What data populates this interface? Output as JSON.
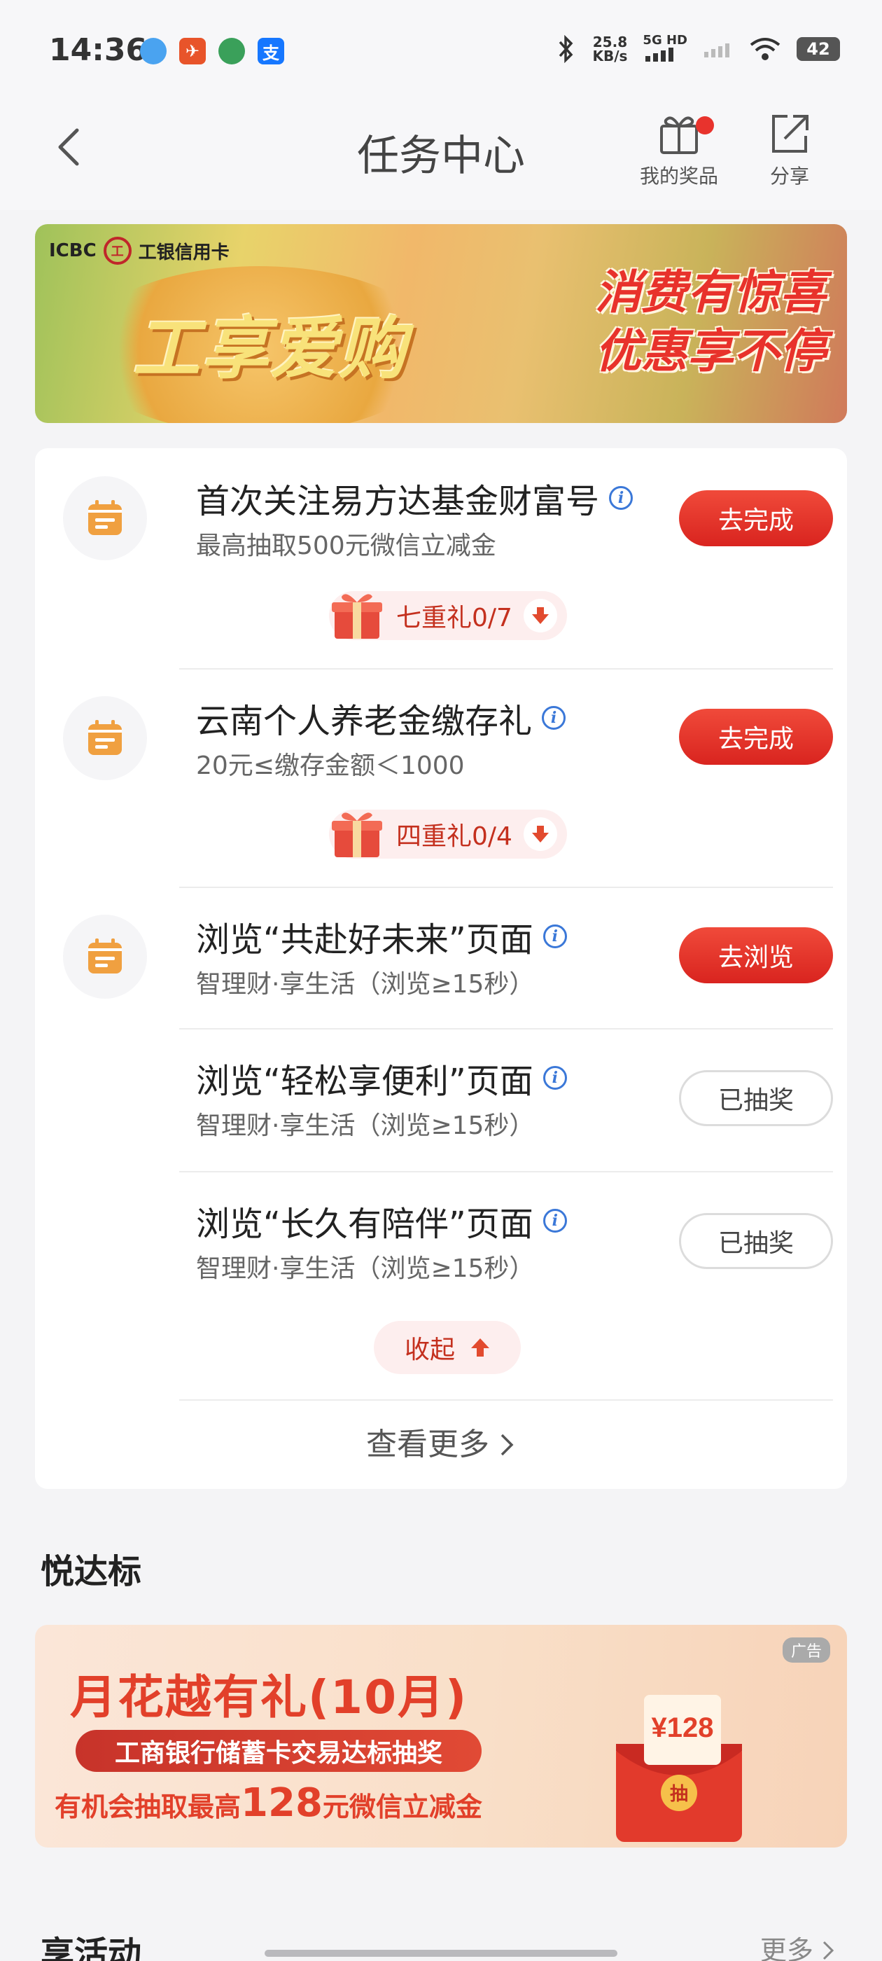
{
  "status_bar": {
    "time": "14:36",
    "apps": [
      {
        "icon": "qq-browser-icon",
        "label": "",
        "color": "#4aa3f0"
      },
      {
        "icon": "app-orange-icon",
        "label": "",
        "color": "#e8542a"
      },
      {
        "icon": "app-green-icon",
        "label": "",
        "color": "#3aa05a"
      },
      {
        "icon": "alipay-icon",
        "label": "支",
        "color": "#1677ff"
      }
    ],
    "net_speed_value": "25.8",
    "net_speed_unit": "KB/s",
    "net_type": "5G HD",
    "battery": "42"
  },
  "header": {
    "title": "任务中心",
    "prizes_label": "我的奖品",
    "share_label": "分享"
  },
  "banner": {
    "bank_label": "ICBC",
    "card_label": "工银信用卡",
    "brand_text": "工享爱购",
    "slogan_line1": "消费有惊喜",
    "slogan_line2": "优惠享不停"
  },
  "tasks": [
    {
      "title": "首次关注易方达基金财富号",
      "subtitle": "最高抽取500元微信立减金",
      "button": "去完成",
      "state": "todo",
      "gift": "七重礼0/7"
    },
    {
      "title": "云南个人养老金缴存礼",
      "subtitle": "20元≤缴存金额＜1000",
      "button": "去完成",
      "state": "todo",
      "gift": "四重礼0/4"
    },
    {
      "title": "浏览“共赴好未来”页面",
      "subtitle": "智理财·享生活（浏览≥15秒）",
      "button": "去浏览",
      "state": "todo"
    },
    {
      "title": "浏览“轻松享便利”页面",
      "subtitle": "智理财·享生活（浏览≥15秒）",
      "button": "已抽奖",
      "state": "done"
    },
    {
      "title": "浏览“长久有陪伴”页面",
      "subtitle": "智理财·享生活（浏览≥15秒）",
      "button": "已抽奖",
      "state": "done"
    }
  ],
  "collapse_label": "收起",
  "more_label": "查看更多",
  "section_yueda": "悦达标",
  "ad": {
    "badge": "广告",
    "title": "月花越有礼(10月)",
    "strip": "工商银行储蓄卡交易达标抽奖",
    "line_prefix": "有机会抽取最高",
    "line_amount": "128",
    "line_suffix": "元微信立减金",
    "envelope_amount": "¥128",
    "envelope_char": "抽"
  },
  "section_bottom": "享活动",
  "bottom_more": "更多",
  "colors": {
    "accent_red": "#e8332d",
    "icon_orange": "#f0a040",
    "info_blue": "#3b78d8"
  }
}
